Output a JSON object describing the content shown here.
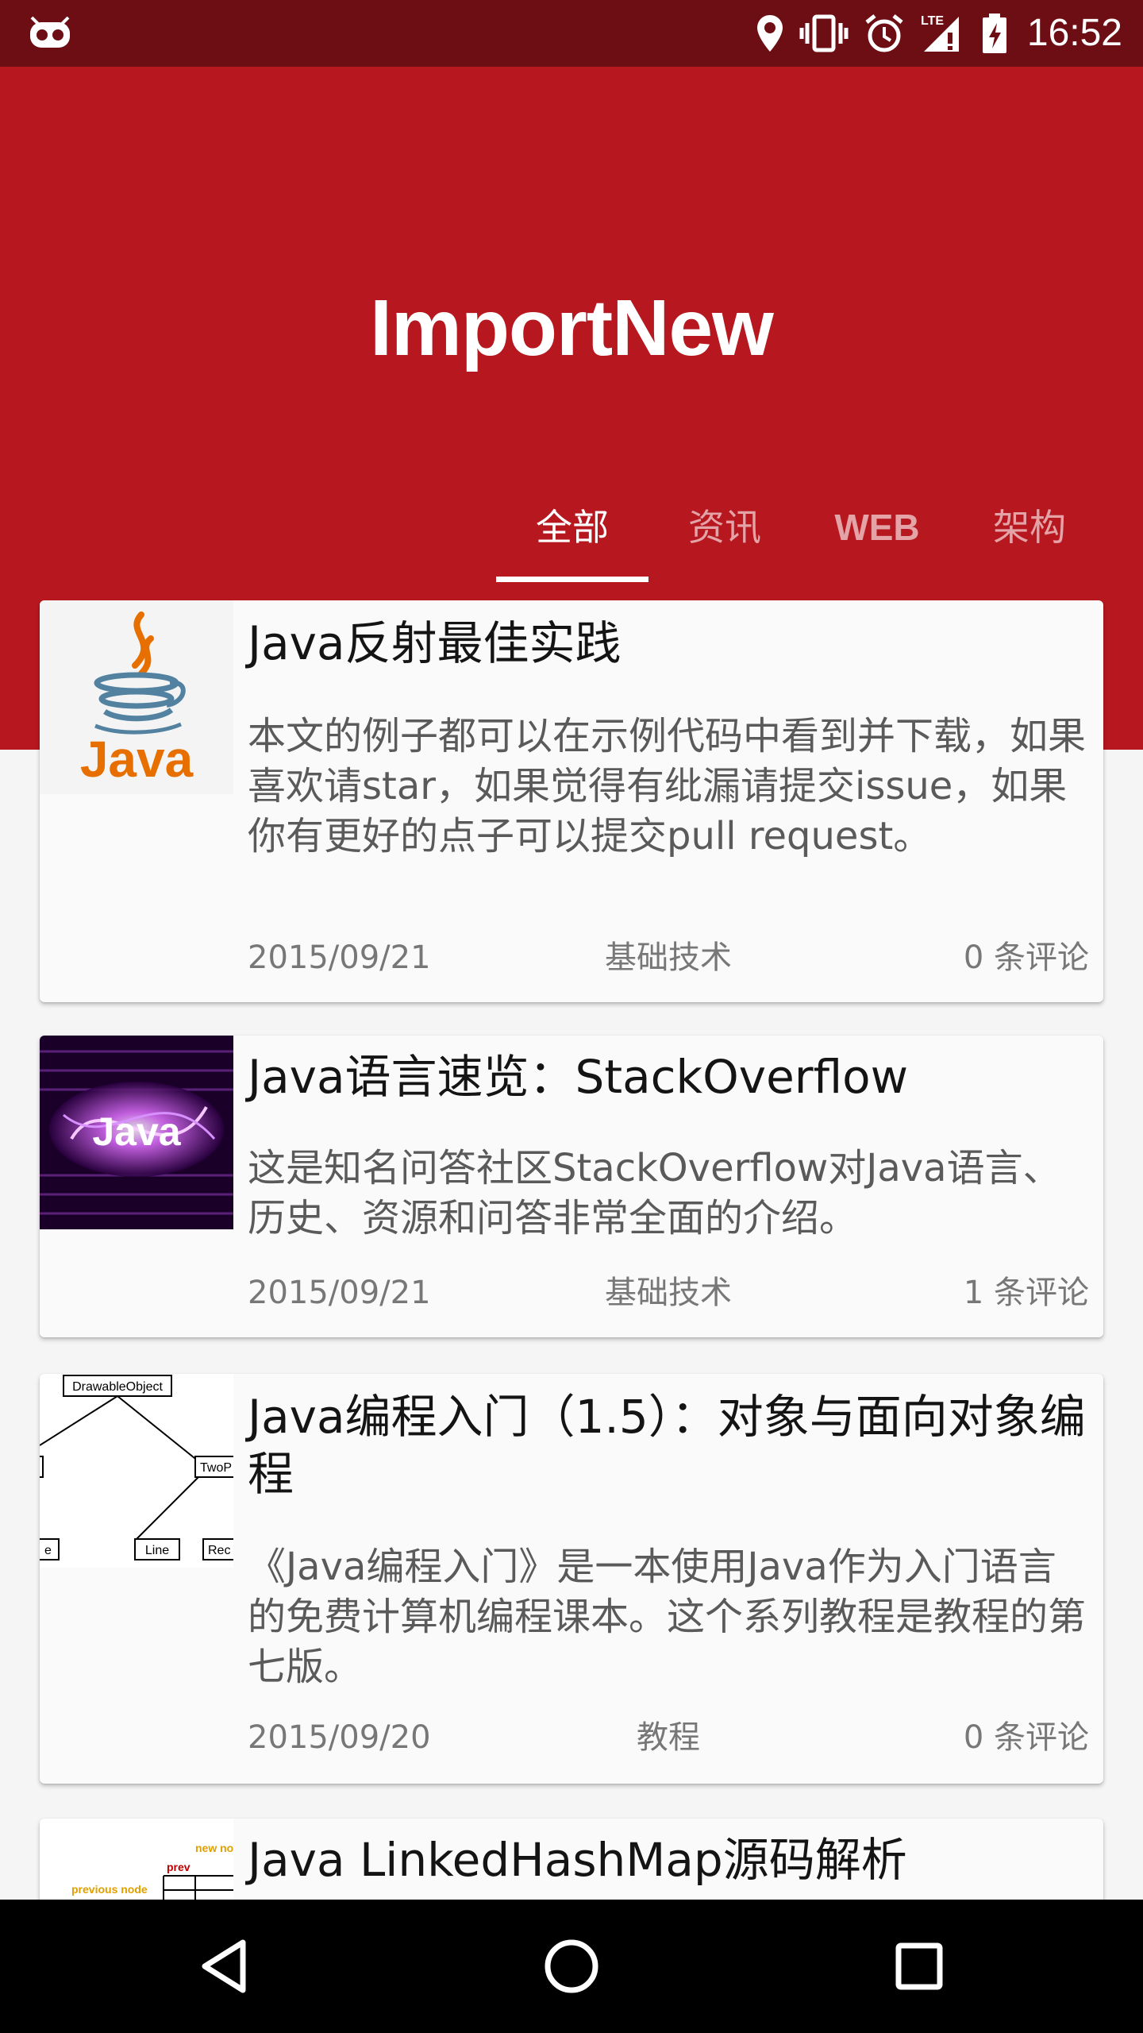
{
  "status_bar": {
    "time": "16:52",
    "icons": [
      "android-debug-icon",
      "location-icon",
      "vibrate-icon",
      "alarm-icon",
      "signal-lte-icon",
      "battery-charging-icon"
    ]
  },
  "header": {
    "title": "ImportNew",
    "tabs": [
      {
        "label": "全部",
        "active": true
      },
      {
        "label": "资讯",
        "active": false
      },
      {
        "label": "WEB",
        "active": false
      },
      {
        "label": "架构",
        "active": false
      }
    ]
  },
  "articles": [
    {
      "title": "Java反射最佳实践",
      "summary": "本文的例子都可以在示例代码中看到并下载，如果喜欢请star，如果觉得有纰漏请提交issue，如果你有更好的点子可以提交pull request。",
      "date": "2015/09/21",
      "category": "基础技术",
      "comments": "0 条评论",
      "thumb": "java-logo"
    },
    {
      "title": "Java语言速览：StackOverflow",
      "summary": "这是知名问答社区StackOverflow对Java语言、历史、资源和问答非常全面的介绍。",
      "date": "2015/09/21",
      "category": "基础技术",
      "comments": "1 条评论",
      "thumb": "java-purple-artwork"
    },
    {
      "title": "Java编程入门（1.5）：对象与面向对象编程",
      "summary": "《Java编程入门》是一本使用Java作为入门语言的免费计算机编程课本。这个系列教程是教程的第七版。",
      "date": "2015/09/20",
      "category": "教程",
      "comments": "0 条评论",
      "thumb": "class-diagram",
      "thumb_labels": [
        "DrawableObject",
        "TwoP",
        "Line",
        "Rec",
        "e"
      ]
    },
    {
      "title": "Java LinkedHashMap源码解析",
      "thumb": "linked-list-diagram",
      "thumb_labels": [
        "new no",
        "prev",
        "previous node"
      ]
    }
  ],
  "colors": {
    "primary": "#b71820",
    "primary_dark": "#6d0e14",
    "tab_inactive": "#e3a3a7",
    "background": "#f5f5f5"
  },
  "nav_bar": {
    "buttons": [
      "back-icon",
      "home-icon",
      "recents-icon"
    ]
  }
}
